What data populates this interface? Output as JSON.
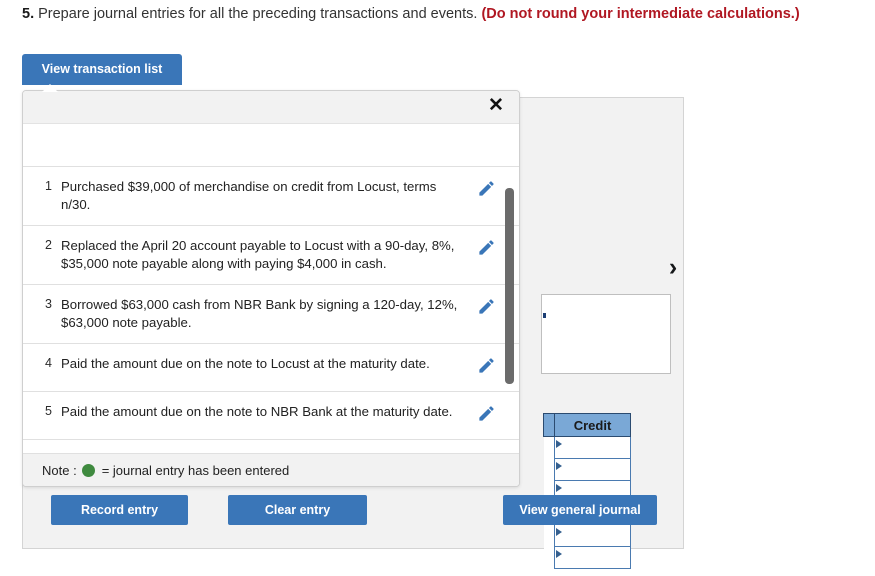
{
  "question": {
    "number": "5.",
    "text": " Prepare journal entries for all the preceding transactions and events. ",
    "warning": "(Do not round your intermediate calculations.)"
  },
  "tab": {
    "view_transaction_list_label": "View transaction list"
  },
  "modal": {
    "close_label": "✕",
    "note_prefix": "Note :",
    "note_text": "= journal entry has been entered",
    "transactions": [
      {
        "num": "1",
        "text": "Purchased $39,000 of merchandise on credit from Locust, terms n/30.",
        "edit_icon": "pencil-icon"
      },
      {
        "num": "2",
        "text": "Replaced the April 20 account payable to Locust with a 90-day, 8%, $35,000 note payable along with paying $4,000 in cash.",
        "edit_icon": "pencil-icon"
      },
      {
        "num": "3",
        "text": "Borrowed $63,000 cash from NBR Bank by signing a 120-day, 12%, $63,000 note payable.",
        "edit_icon": "pencil-icon"
      },
      {
        "num": "4",
        "text": "Paid the amount due on the note to Locust at the maturity date.",
        "edit_icon": "pencil-icon"
      },
      {
        "num": "5",
        "text": "Paid the amount due on the note to NBR Bank at the maturity date.",
        "edit_icon": "pencil-icon"
      }
    ]
  },
  "work_panel": {
    "next_chevron": "›",
    "memo_value": "",
    "journal_table": {
      "columns": [
        "Credit"
      ],
      "rows": [
        {
          "credit": ""
        },
        {
          "credit": ""
        },
        {
          "credit": ""
        },
        {
          "credit": ""
        },
        {
          "credit": ""
        },
        {
          "credit": ""
        }
      ]
    }
  },
  "actions": {
    "record_entry_label": "Record entry",
    "clear_entry_label": "Clear entry",
    "view_general_journal_label": "View general journal"
  },
  "colors": {
    "primary_button": "#3a76b8",
    "warning_text": "#b01722",
    "table_header": "#7aa8d6",
    "table_border": "#4a7ab0",
    "note_dot": "#3f8a3f",
    "panel_background": "#f2f2f2",
    "scrollbar_thumb": "#6b6b6b"
  }
}
